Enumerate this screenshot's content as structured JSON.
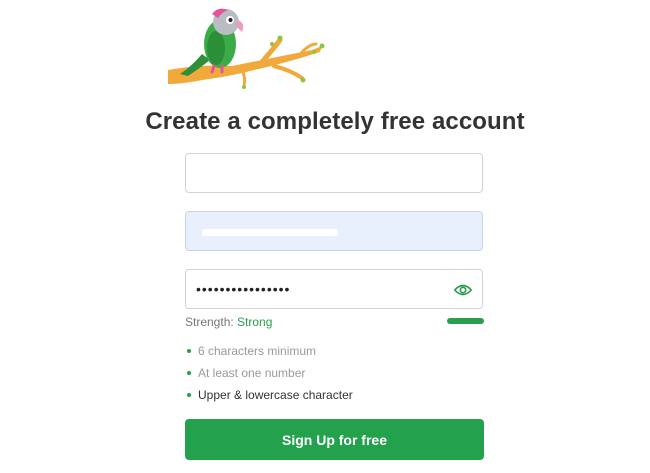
{
  "header": {
    "logo_icon": "parrot-on-branch-icon",
    "title": "Create a completely free account"
  },
  "form": {
    "name_field": {
      "value": "",
      "placeholder": ""
    },
    "email_field": {
      "value": "",
      "placeholder": "",
      "autofilled": true,
      "redacted": true
    },
    "password_field": {
      "value": "••••••••••••••••",
      "masked": true,
      "toggle_icon": "eye-icon"
    },
    "strength": {
      "label": "Strength:",
      "value": "Strong",
      "level": 1.0,
      "color": "#2a9d4e"
    },
    "requirements": [
      {
        "text": "6 characters minimum",
        "met": true
      },
      {
        "text": "At least one number",
        "met": true
      },
      {
        "text": "Upper & lowercase character",
        "met": false
      }
    ],
    "submit_label": "Sign Up for free"
  },
  "colors": {
    "accent": "#23a14d",
    "title": "#333333",
    "autofill_bg": "#e8f0fe"
  }
}
